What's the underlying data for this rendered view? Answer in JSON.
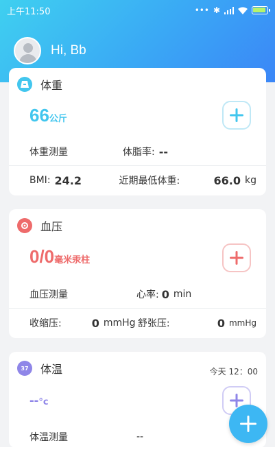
{
  "status_bar": {
    "time": "上午11:50",
    "icons": [
      "more-dots-icon",
      "bluetooth-icon",
      "signal-icon",
      "wifi-icon",
      "battery-icon"
    ]
  },
  "profile": {
    "greeting": "Hi, Bb"
  },
  "colors": {
    "header_start": "#3fd0f0",
    "header_end": "#3b86f7",
    "weight_accent": "#42c6ee",
    "bp_accent": "#ee6b6b",
    "temp_accent": "#8f86e8",
    "fab": "#3db7f3"
  },
  "weight_card": {
    "title": "体重",
    "value": "66",
    "unit": "公斤",
    "measure_label": "体重测量",
    "body_fat_label": "体脂率:",
    "body_fat_value": "--",
    "bmi_label": "BMI:",
    "bmi_value": "24.2",
    "lowest_label": "近期最低体重:",
    "lowest_value": "66.0",
    "lowest_unit": "kg"
  },
  "bp_card": {
    "title": "血压",
    "value": "0/0",
    "unit": "毫米汞柱",
    "measure_label": "血压测量",
    "heart_rate_label": "心率:",
    "heart_rate_value": "0",
    "heart_rate_unit": "min",
    "systolic_label": "收缩压:",
    "systolic_value": "0",
    "systolic_unit": "mmHg",
    "diastolic_label": "舒张压:",
    "diastolic_value": "0",
    "diastolic_unit": "mmHg"
  },
  "temp_card": {
    "title": "体温",
    "timestamp": "今天 12：00",
    "icon_text": "37",
    "value": "--",
    "unit": "°c",
    "measure_label": "体温测量",
    "measure_value": "--"
  }
}
